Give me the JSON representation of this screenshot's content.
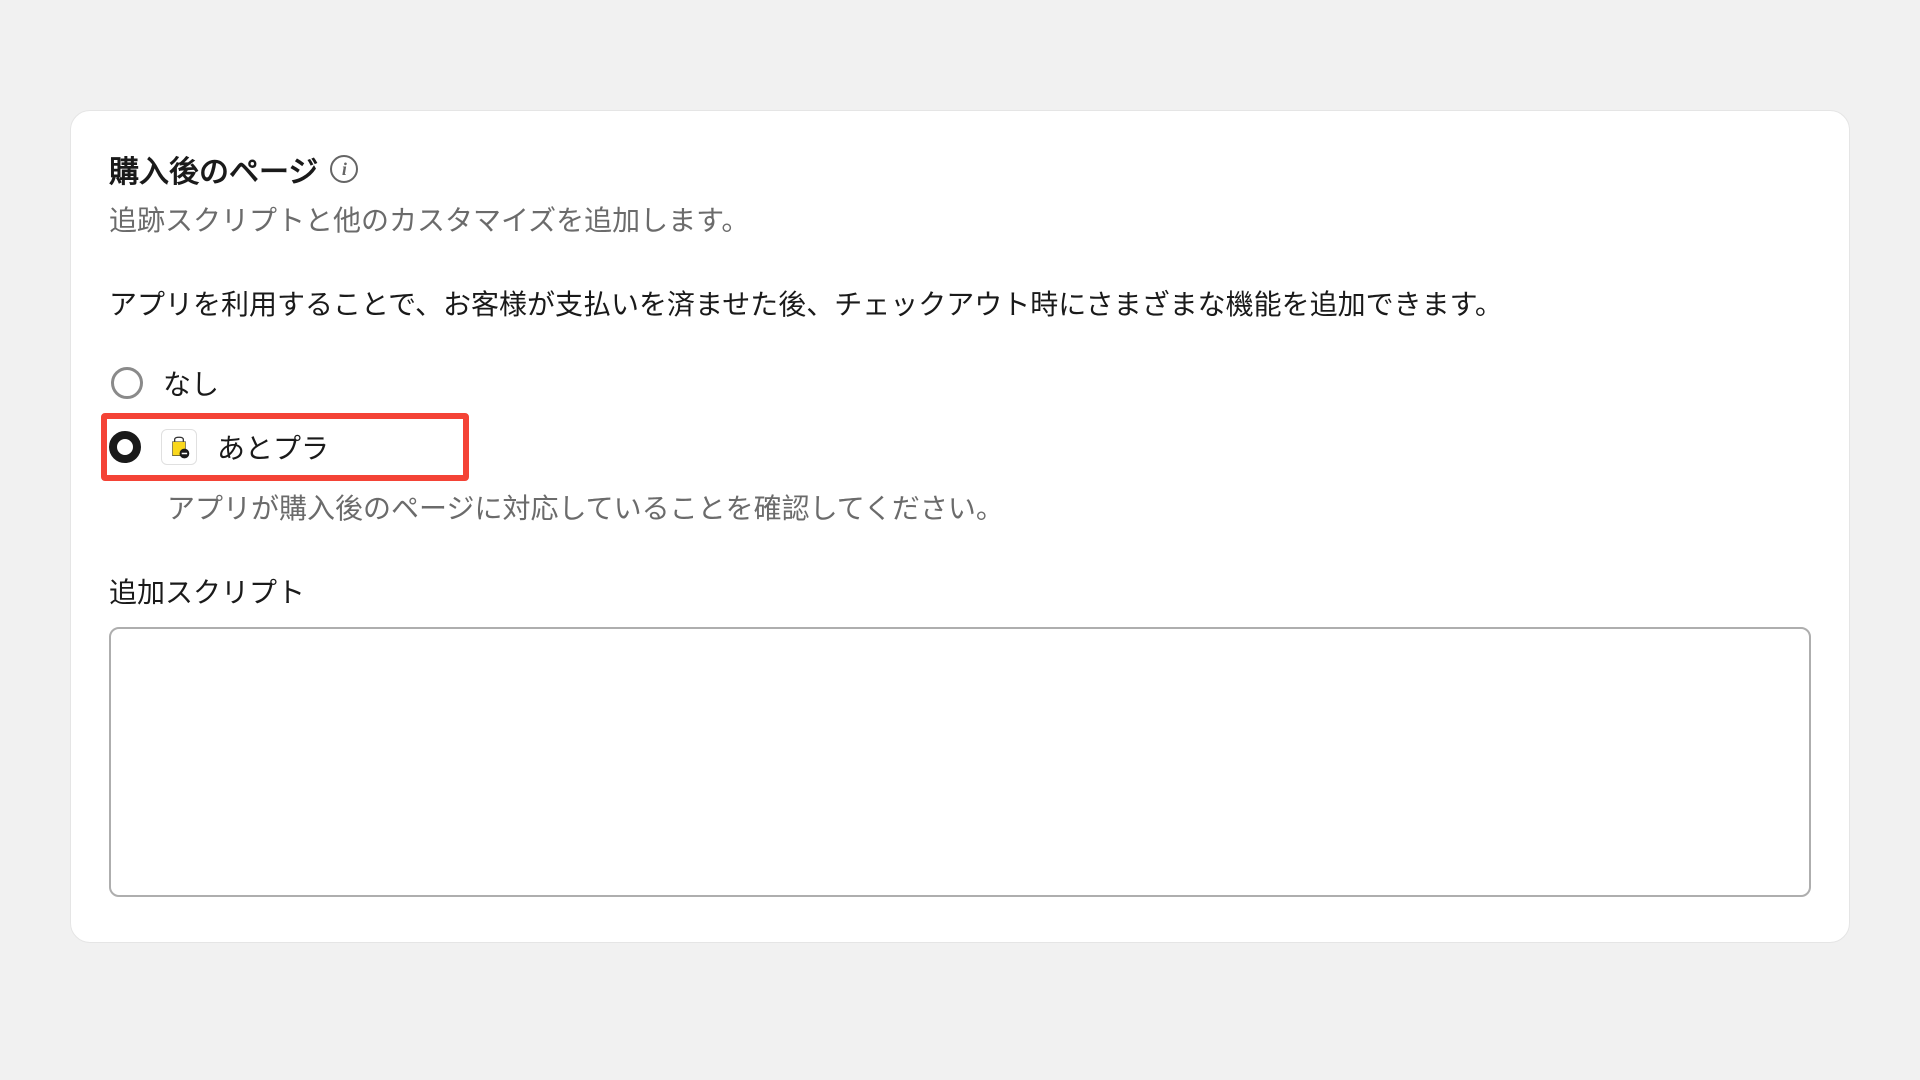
{
  "section": {
    "title": "購入後のページ",
    "subtitle": "追跡スクリプトと他のカスタマイズを追加します。",
    "description": "アプリを利用することで、お客様が支払いを済ませた後、チェックアウト時にさまざまな機能を追加できます。"
  },
  "radio_options": {
    "none_label": "なし",
    "app_label": "あとプラ",
    "selected": "app",
    "helper_text": "アプリが購入後のページに対応していることを確認してください。"
  },
  "script_field": {
    "label": "追加スクリプト",
    "value": ""
  },
  "info_glyph": "i"
}
